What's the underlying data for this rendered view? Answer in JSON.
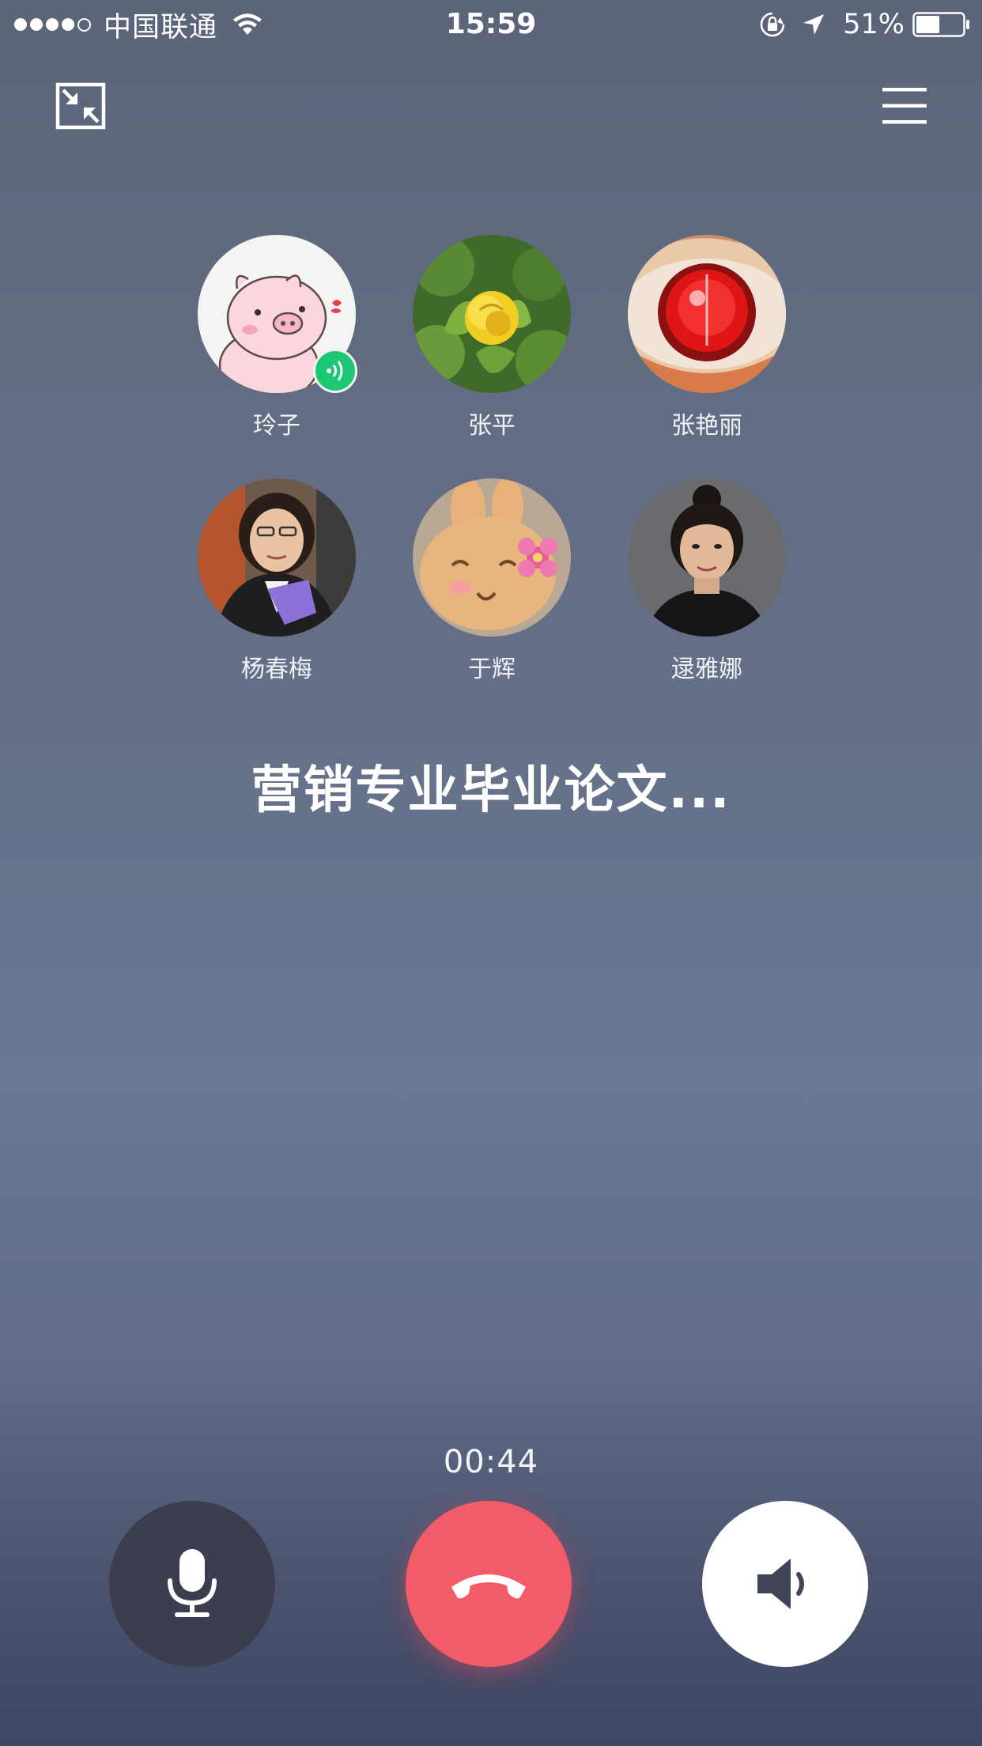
{
  "status_bar": {
    "carrier": "中国联通",
    "time": "15:59",
    "battery_percent": "51%",
    "battery_level": 0.51,
    "signal_bars_filled": 4,
    "signal_bars_total": 5,
    "icons": [
      "signal-dots",
      "wifi-icon",
      "rotation-lock-icon",
      "location-arrow-icon",
      "battery-icon"
    ]
  },
  "top_bar": {
    "left_icon": "minimize-window-icon",
    "right_icon": "menu-icon"
  },
  "participants": [
    {
      "name": "玲子",
      "avatar": "pig-cartoon",
      "speaking": true
    },
    {
      "name": "张平",
      "avatar": "yellow-rose"
    },
    {
      "name": "张艳丽",
      "avatar": "red-eye-art"
    },
    {
      "name": "杨春梅",
      "avatar": "woman-photo"
    },
    {
      "name": "于辉",
      "avatar": "cartoon-bunny"
    },
    {
      "name": "逯雅娜",
      "avatar": "woman-portrait"
    }
  ],
  "call": {
    "group_name": "营销专业毕业论文...",
    "duration": "00:44"
  },
  "controls": {
    "mute_icon": "microphone-icon",
    "hangup_icon": "hang-up-icon",
    "speaker_icon": "speaker-icon"
  },
  "colors": {
    "speaking_badge": "#1ec773",
    "hangup": "#f35b68",
    "mic_button": "#3a3e4f",
    "speaker_button": "#ffffff"
  }
}
